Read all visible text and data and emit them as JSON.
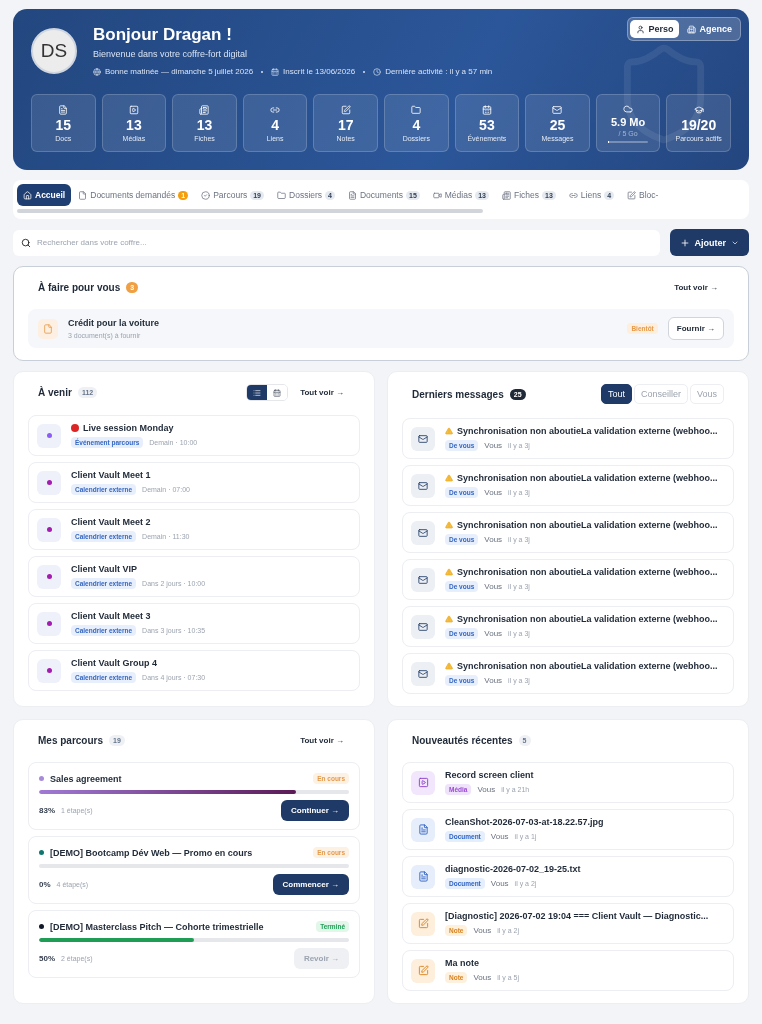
{
  "header": {
    "avatar": "DS",
    "title": "Bonjour Dragan !",
    "subtitle": "Bienvenue dans votre coffre-fort digital",
    "meta": [
      "Bonne matinée — dimanche 5 juillet 2026",
      "Inscrit le 13/06/2026",
      "Dernière activité : il y a 57 min"
    ],
    "modes": [
      {
        "label": "Perso",
        "selected": true
      },
      {
        "label": "Agence",
        "selected": false
      }
    ],
    "stats": [
      {
        "value": "15",
        "label": "Docs"
      },
      {
        "value": "13",
        "label": "Médias"
      },
      {
        "value": "13",
        "label": "Fiches"
      },
      {
        "value": "4",
        "label": "Liens"
      },
      {
        "value": "17",
        "label": "Notes"
      },
      {
        "value": "4",
        "label": "Dossiers"
      },
      {
        "value": "53",
        "label": "Événements"
      },
      {
        "value": "25",
        "label": "Messages"
      },
      {
        "value": "5.9 Mo",
        "sublabel": "/ 5 Go",
        "level": 0.01
      },
      {
        "value": "19/20",
        "label": "Parcours actifs"
      }
    ]
  },
  "tabs": [
    {
      "label": "Accueil",
      "selected": true
    },
    {
      "label": "Documents demandés",
      "count": "1",
      "alert": true,
      "selected": false
    },
    {
      "label": "Parcours",
      "count": "19",
      "alert": false,
      "selected": false
    },
    {
      "label": "Dossiers",
      "count": "4",
      "alert": false,
      "selected": false
    },
    {
      "label": "Documents",
      "count": "15",
      "alert": false,
      "selected": false
    },
    {
      "label": "Médias",
      "count": "13",
      "alert": false,
      "selected": false
    },
    {
      "label": "Fiches",
      "count": "13",
      "alert": false,
      "selected": false
    },
    {
      "label": "Liens",
      "count": "4",
      "alert": false,
      "selected": false
    },
    {
      "label": "Bloc-",
      "selected": false
    }
  ],
  "search": {
    "placeholder": "Rechercher dans votre coffre..."
  },
  "add_button": "Ajouter",
  "todo": {
    "title": "À faire pour vous",
    "count": "3",
    "link": "Tout voir →",
    "items": [
      {
        "title": "Crédit pour la voiture",
        "subtitle": "3 document(s) à fournir",
        "tag": "Bientôt",
        "button": "Fournir →"
      }
    ]
  },
  "events": {
    "title": "À venir",
    "count": "112",
    "link": "Tout voir →",
    "views": [
      {
        "selected": true
      },
      {
        "selected": false
      }
    ],
    "items": [
      {
        "title": "Live session Monday",
        "live": true,
        "tag": "Événement parcours",
        "time": "Demain · 10:00",
        "color": "#8b5cf6"
      },
      {
        "title": "Client Vault Meet 1",
        "live": false,
        "tag": "Calendrier externe",
        "time": "Demain · 07:00",
        "color": "#a21caf"
      },
      {
        "title": "Client Vault Meet 2",
        "live": false,
        "tag": "Calendrier externe",
        "time": "Demain · 11:30",
        "color": "#a21caf"
      },
      {
        "title": "Client Vault VIP",
        "live": false,
        "tag": "Calendrier externe",
        "time": "Dans 2 jours · 10:00",
        "color": "#a21caf"
      },
      {
        "title": "Client Vault Meet 3",
        "live": false,
        "tag": "Calendrier externe",
        "time": "Dans 3 jours · 10:35",
        "color": "#a21caf"
      },
      {
        "title": "Client Vault Group 4",
        "live": false,
        "tag": "Calendrier externe",
        "time": "Dans 4 jours · 07:30",
        "color": "#a21caf"
      }
    ]
  },
  "messages": {
    "title": "Derniers messages",
    "count": "25",
    "filters": [
      {
        "label": "Tout",
        "selected": true
      },
      {
        "label": "Conseiller",
        "selected": false
      },
      {
        "label": "Vous",
        "selected": false
      }
    ],
    "items": [
      {
        "title": "Synchronisation non aboutieLa validation externe (webhoo...",
        "tag": "De vous",
        "author": "Vous",
        "time": "il y a 3j"
      },
      {
        "title": "Synchronisation non aboutieLa validation externe (webhoo...",
        "tag": "De vous",
        "author": "Vous",
        "time": "il y a 3j"
      },
      {
        "title": "Synchronisation non aboutieLa validation externe (webhoo...",
        "tag": "De vous",
        "author": "Vous",
        "time": "il y a 3j"
      },
      {
        "title": "Synchronisation non aboutieLa validation externe (webhoo...",
        "tag": "De vous",
        "author": "Vous",
        "time": "il y a 3j"
      },
      {
        "title": "Synchronisation non aboutieLa validation externe (webhoo...",
        "tag": "De vous",
        "author": "Vous",
        "time": "il y a 3j"
      },
      {
        "title": "Synchronisation non aboutieLa validation externe (webhoo...",
        "tag": "De vous",
        "author": "Vous",
        "time": "il y a 3j"
      }
    ]
  },
  "journeys": {
    "title": "Mes parcours",
    "count": "19",
    "link": "Tout voir →",
    "items": [
      {
        "title": "Sales agreement",
        "color": "#a78bda",
        "status": "En cours",
        "kind": "in_progress",
        "level": 0.83,
        "percent": "83%",
        "steps": "1 étape(s)",
        "button": "Continuer →"
      },
      {
        "title": "[DEMO] Bootcamp Dév Web — Promo en cours",
        "color": "#0f766e",
        "status": "En cours",
        "kind": "in_progress",
        "level": 0,
        "percent": "0%",
        "steps": "4 étape(s)",
        "button": "Commencer →"
      },
      {
        "title": "[DEMO] Masterclass Pitch — Cohorte trimestrielle",
        "color": "#111827",
        "status": "Terminé",
        "kind": "done",
        "level": 0.5,
        "percent": "50%",
        "steps": "2 étape(s)",
        "button": "Revoir →"
      }
    ]
  },
  "recent": {
    "title": "Nouveautés récentes",
    "count": "5",
    "items": [
      {
        "kind": "media",
        "title": "Record screen client",
        "tag": "Média",
        "author": "Vous",
        "time": "il y a 21h"
      },
      {
        "kind": "document",
        "title": "CleanShot-2026-07-03-at-18.22.57.jpg",
        "tag": "Document",
        "author": "Vous",
        "time": "il y a 1j"
      },
      {
        "kind": "document",
        "title": "diagnostic-2026-07-02_19-25.txt",
        "tag": "Document",
        "author": "Vous",
        "time": "il y a 2j"
      },
      {
        "kind": "note",
        "title": "[Diagnostic] 2026-07-02 19:04 === Client Vault — Diagnostic...",
        "tag": "Note",
        "author": "Vous",
        "time": "il y a 2j"
      },
      {
        "kind": "note",
        "title": "Ma note",
        "tag": "Note",
        "author": "Vous",
        "time": "il y a 5j"
      }
    ]
  }
}
